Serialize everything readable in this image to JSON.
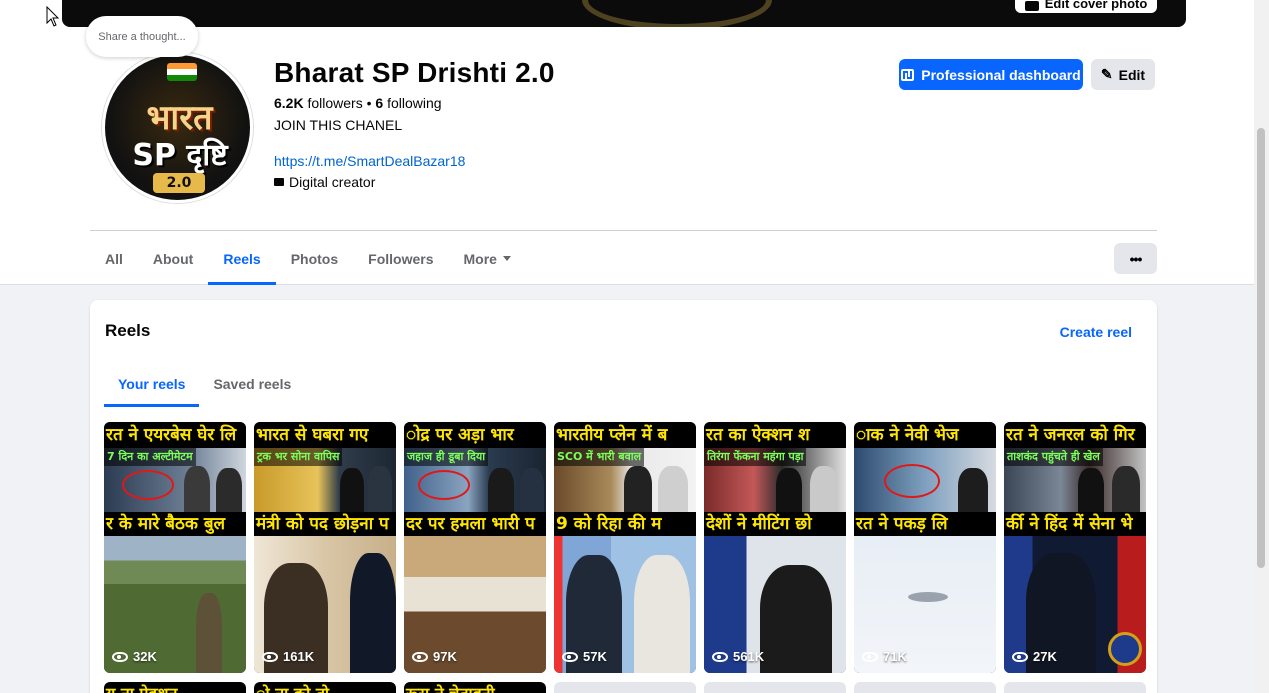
{
  "cover": {
    "edit_cover_label": "Edit cover photo"
  },
  "thought_bubble": "Share a thought...",
  "profile": {
    "name": "Bharat SP Drishti 2.0",
    "followers_count": "6.2K",
    "followers_label": "followers",
    "separator": "•",
    "following_count": "6",
    "following_label": "following",
    "bio": "JOIN THIS CHANEL",
    "link": "https://t.me/SmartDealBazar18",
    "category": "Digital creator",
    "avatar_text": {
      "line1": "भारत",
      "line2": "SP दृष्टि",
      "line3": "2.0"
    }
  },
  "actions": {
    "professional_dashboard": "Professional dashboard",
    "edit": "Edit",
    "more_options": "•••"
  },
  "tabs": [
    {
      "label": "All",
      "active": false
    },
    {
      "label": "About",
      "active": false
    },
    {
      "label": "Reels",
      "active": true
    },
    {
      "label": "Photos",
      "active": false
    },
    {
      "label": "Followers",
      "active": false
    },
    {
      "label": "More",
      "active": false
    }
  ],
  "reels_section": {
    "title": "Reels",
    "create_label": "Create reel",
    "sub_tabs": [
      {
        "label": "Your reels",
        "active": true
      },
      {
        "label": "Saved reels",
        "active": false
      }
    ]
  },
  "reels": [
    {
      "headline_top": "रत ने एयरबेस घेर लि",
      "subtitle": "7 दिन का अल्टीमेटम",
      "headline_bottom": "र के मारे बैठक बुल",
      "views": "32K"
    },
    {
      "headline_top": "भारत से घबरा गए",
      "subtitle": "ट्रक भर सोना वापिस",
      "headline_bottom": "मंत्री को पद छोड़ना प",
      "views": "161K"
    },
    {
      "headline_top": "ोद्र पर अड़ा भार",
      "subtitle": "जहाज ही डूबा दिया",
      "headline_bottom": "दर पर हमला भारी प",
      "views": "97K"
    },
    {
      "headline_top": "भारतीय प्लेन में ब",
      "subtitle": "SCO में भारी बवाल",
      "headline_bottom": "9 को रिहा की म",
      "views": "57K"
    },
    {
      "headline_top": "रत का ऐक्शन श",
      "subtitle": "तिरंगा फेंकना महंगा पड़ा",
      "headline_bottom": "देशों ने मीटिंग छो",
      "views": "561K"
    },
    {
      "headline_top": "ाक ने नेवी भेज",
      "subtitle": "",
      "headline_bottom": "रत ने पकड़ लि",
      "views": "71K"
    },
    {
      "headline_top": "रत ने जनरल को गिर",
      "subtitle": "ताशकंद पहुंचते ही खेल",
      "headline_bottom": "र्की ने हिंद में सेना भे",
      "views": "27K"
    }
  ],
  "next_row": [
    {
      "headline": "य ना ऐक्शन",
      "type": "img"
    },
    {
      "headline": "ो ना को तो",
      "type": "img"
    },
    {
      "headline": "रूस ने चेतावनी",
      "type": "img"
    },
    {
      "headline": "",
      "type": "blank"
    },
    {
      "headline": "",
      "type": "blank"
    },
    {
      "headline": "",
      "type": "blank"
    },
    {
      "headline": "",
      "type": "blank"
    }
  ],
  "colors": {
    "accent": "#0866ff",
    "link": "#0064d1",
    "headline_yellow": "#ffe600",
    "subtitle_green": "#7CFF5A"
  }
}
